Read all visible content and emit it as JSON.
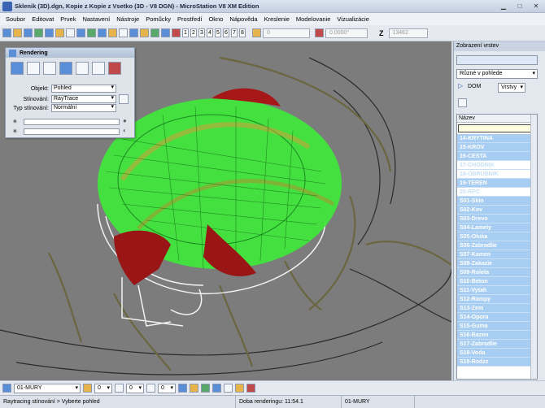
{
  "window": {
    "title": "Sklenik (3D).dgn, Kopie z Kopie z Vsetko (3D - V8 DGN) - MicroStation V8 XM Edition"
  },
  "menu": [
    "Soubor",
    "Editovat",
    "Prvek",
    "Nastavení",
    "Nástroje",
    "Pomůcky",
    "Prostředí",
    "Okno",
    "Nápověda",
    "Kreslenie",
    "Modelovanie",
    "Vizualizácie"
  ],
  "toolbar": {
    "view_numbers": [
      "1",
      "2",
      "3",
      "4",
      "5",
      "6",
      "7",
      "8"
    ],
    "x_value": "0",
    "angle_value": "0.0000°",
    "z_label": "Z",
    "z_value": "13462"
  },
  "rendering": {
    "title": "Rendering",
    "objekt_label": "Objekt:",
    "objekt_value": "Pohled",
    "stinovani_label": "Stínování:",
    "stinovani_value": "RayTrace",
    "typ_label": "Typ stínování:",
    "typ_value": "Normální"
  },
  "layer_panel": {
    "title": "Zobrazení vrstev",
    "mode": "Různé v pohlede",
    "dom_label": "DOM",
    "vrstvy_label": "Vrstvy",
    "column_header": "Název",
    "rows": [
      {
        "name": "14-KRYTINA",
        "on": true
      },
      {
        "name": "15-KROV",
        "on": true
      },
      {
        "name": "16-CESTA",
        "on": true
      },
      {
        "name": "17-CHODNIK",
        "on": false
      },
      {
        "name": "18-OBRUBNIK",
        "on": false
      },
      {
        "name": "19-TEREN",
        "on": true
      },
      {
        "name": "20-RPC",
        "on": false
      },
      {
        "name": "S01-Sklo",
        "on": true
      },
      {
        "name": "S02-Kov",
        "on": true
      },
      {
        "name": "S03-Drevo",
        "on": true
      },
      {
        "name": "S04-Lamely",
        "on": true
      },
      {
        "name": "S05-Oluka",
        "on": true
      },
      {
        "name": "S06-Zabradlie",
        "on": true
      },
      {
        "name": "S07-Kamen",
        "on": true
      },
      {
        "name": "S08-Zakazie",
        "on": true
      },
      {
        "name": "S09-Roleta",
        "on": true
      },
      {
        "name": "S10-Beton",
        "on": true
      },
      {
        "name": "S11-Vytah",
        "on": true
      },
      {
        "name": "S12-Rampy",
        "on": true
      },
      {
        "name": "S13-Zem",
        "on": true
      },
      {
        "name": "S14-Opora",
        "on": true
      },
      {
        "name": "S15-Guma",
        "on": true
      },
      {
        "name": "S16-Bazen",
        "on": true
      },
      {
        "name": "S17-Zabradlie",
        "on": true
      },
      {
        "name": "S18-Voda",
        "on": true
      },
      {
        "name": "S19-Rodzz",
        "on": true
      }
    ]
  },
  "bottom": {
    "level": "01-MURY",
    "values": [
      "0",
      "0",
      "0"
    ]
  },
  "status": {
    "left": "Raytracing stínování > Vyberte pohled",
    "render_time": "Doba renderingu: 11:54.1",
    "level": "01-MURY"
  },
  "colors": {
    "viewport_bg": "#7c7c7c",
    "glass": "#3fe83a",
    "roof": "#a61818",
    "layer_selected": "#a8cdf2"
  }
}
